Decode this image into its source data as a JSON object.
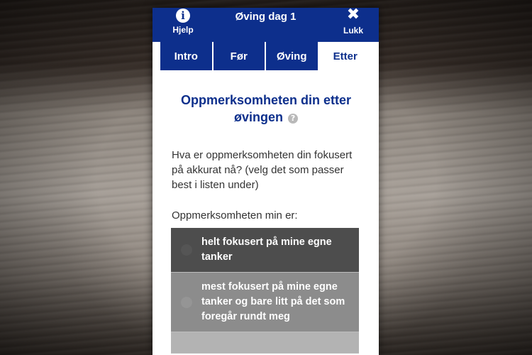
{
  "header": {
    "title": "Øving dag 1",
    "help_label": "Hjelp",
    "close_label": "Lukk",
    "help_icon_glyph": "i",
    "close_icon_glyph": "✖",
    "color": "#0d2f8c"
  },
  "tabs": [
    {
      "label": "Intro",
      "active": false
    },
    {
      "label": "Før",
      "active": false
    },
    {
      "label": "Øving",
      "active": false
    },
    {
      "label": "Etter",
      "active": true
    }
  ],
  "main": {
    "title": "Oppmerksomheten din etter øvingen",
    "help_glyph": "?",
    "question": "Hva er oppmerksomheten din fokusert på akkurat nå? (velg det som passer best i listen under)",
    "sublabel": "Oppmerksomheten min er:",
    "options": [
      {
        "label": "helt fokusert på mine egne tanker",
        "shade": "dark"
      },
      {
        "label": "mest fokusert på mine egne tanker og bare litt på det som foregår rundt meg",
        "shade": "mid"
      },
      {
        "label": "",
        "shade": "light"
      }
    ]
  }
}
